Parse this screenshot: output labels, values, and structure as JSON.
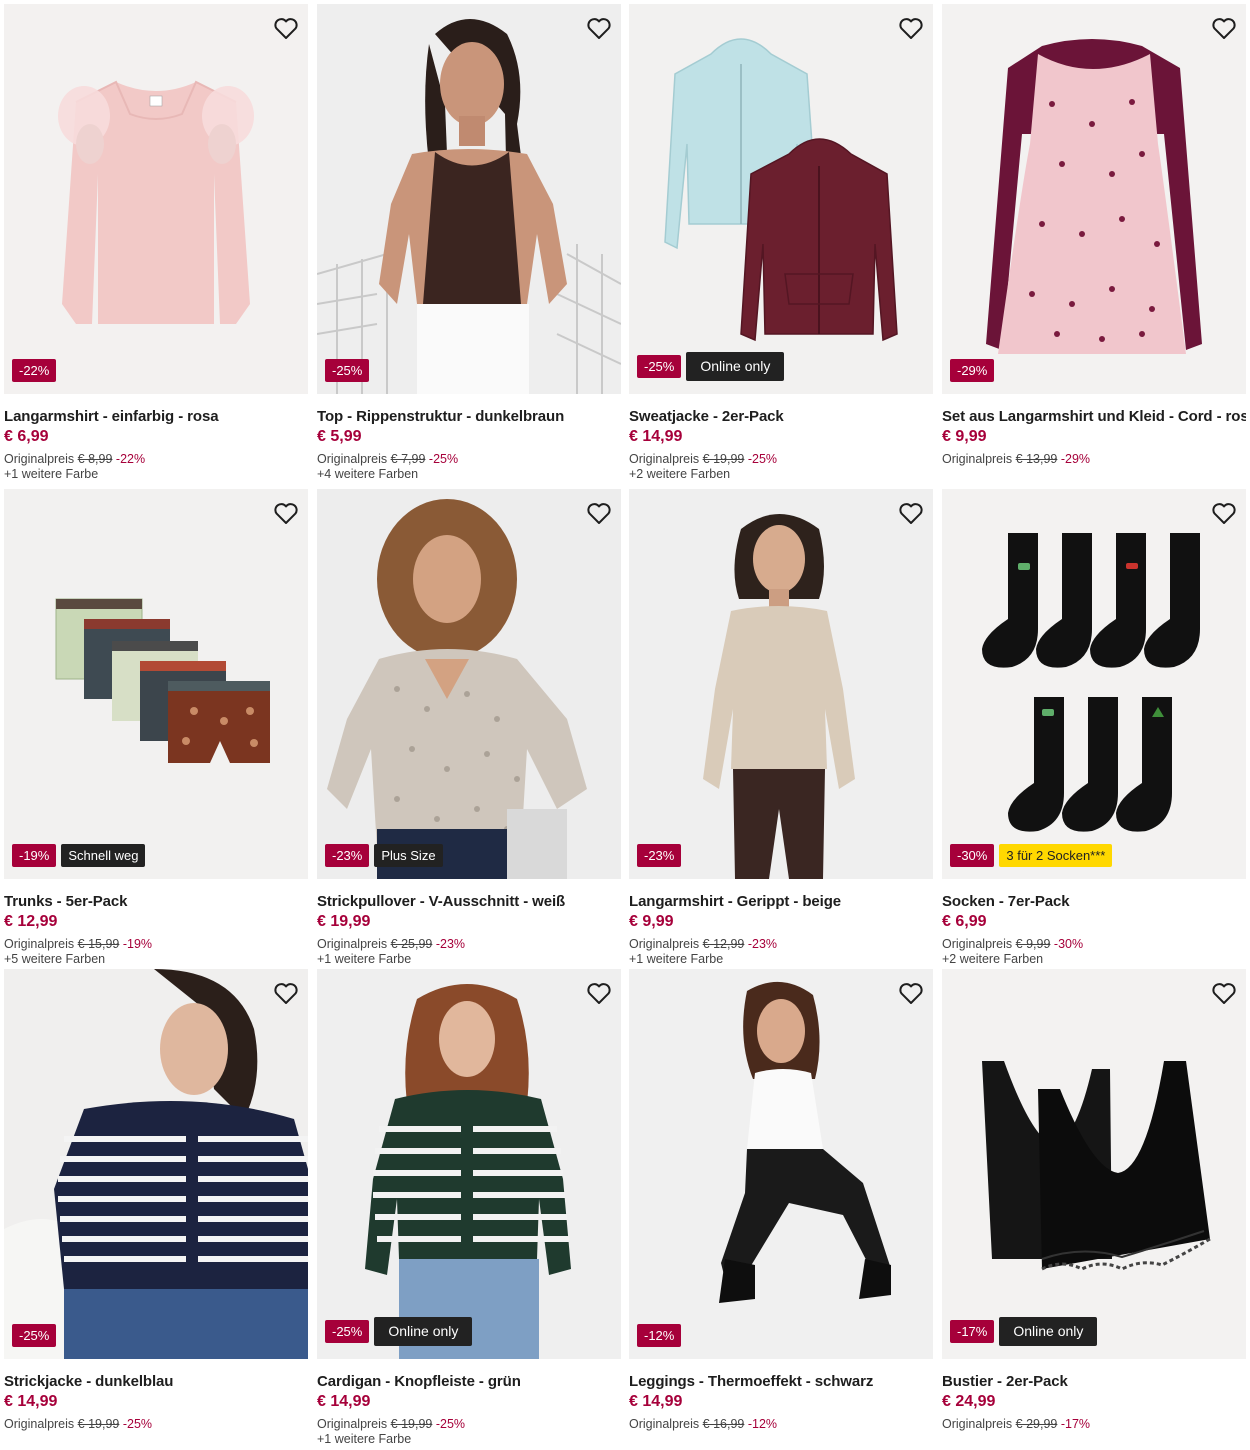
{
  "products": [
    {
      "name": "Langarmshirt - einfarbig - rosa",
      "price": "€ 6,99",
      "original_label": "Originalpreis",
      "original_price": "€ 8,99",
      "discount": "-22%",
      "discount_badge": "-22%",
      "extra_badge": "",
      "colors": "+1 weitere Farbe"
    },
    {
      "name": "Top - Rippenstruktur - dunkelbraun",
      "price": "€ 5,99",
      "original_label": "Originalpreis",
      "original_price": "€ 7,99",
      "discount": "-25%",
      "discount_badge": "-25%",
      "extra_badge": "",
      "colors": "+4 weitere Farben"
    },
    {
      "name": "Sweatjacke - 2er-Pack",
      "price": "€ 14,99",
      "original_label": "Originalpreis",
      "original_price": "€ 19,99",
      "discount": "-25%",
      "discount_badge": "-25%",
      "extra_badge": "Online only",
      "colors": "+2 weitere Farben"
    },
    {
      "name": "Set aus Langarmshirt und Kleid - Cord - rosa",
      "price": "€ 9,99",
      "original_label": "Originalpreis",
      "original_price": "€ 13,99",
      "discount": "-29%",
      "discount_badge": "-29%",
      "extra_badge": "",
      "colors": ""
    },
    {
      "name": "Trunks - 5er-Pack",
      "price": "€ 12,99",
      "original_label": "Originalpreis",
      "original_price": "€ 15,99",
      "discount": "-19%",
      "discount_badge": "-19%",
      "extra_badge": "Schnell weg",
      "colors": "+5 weitere Farben"
    },
    {
      "name": "Strickpullover - V-Ausschnitt - weiß",
      "price": "€ 19,99",
      "original_label": "Originalpreis",
      "original_price": "€ 25,99",
      "discount": "-23%",
      "discount_badge": "-23%",
      "extra_badge": "Plus Size",
      "colors": "+1 weitere Farbe"
    },
    {
      "name": "Langarmshirt - Gerippt - beige",
      "price": "€ 9,99",
      "original_label": "Originalpreis",
      "original_price": "€ 12,99",
      "discount": "-23%",
      "discount_badge": "-23%",
      "extra_badge": "",
      "colors": "+1 weitere Farbe"
    },
    {
      "name": "Socken - 7er-Pack",
      "price": "€ 6,99",
      "original_label": "Originalpreis",
      "original_price": "€ 9,99",
      "discount": "-30%",
      "discount_badge": "-30%",
      "extra_badge": "3 für 2 Socken***",
      "colors": "+2 weitere Farben"
    },
    {
      "name": "Strickjacke - dunkelblau",
      "price": "€ 14,99",
      "original_label": "Originalpreis",
      "original_price": "€ 19,99",
      "discount": "-25%",
      "discount_badge": "-25%",
      "extra_badge": "",
      "colors": ""
    },
    {
      "name": "Cardigan - Knopfleiste - grün",
      "price": "€ 14,99",
      "original_label": "Originalpreis",
      "original_price": "€ 19,99",
      "discount": "-25%",
      "discount_badge": "-25%",
      "extra_badge": "Online only",
      "colors": "+1 weitere Farbe"
    },
    {
      "name": "Leggings - Thermoeffekt - schwarz",
      "price": "€ 14,99",
      "original_label": "Originalpreis",
      "original_price": "€ 16,99",
      "discount": "-12%",
      "discount_badge": "-12%",
      "extra_badge": "",
      "colors": ""
    },
    {
      "name": "Bustier - 2er-Pack",
      "price": "€ 24,99",
      "original_label": "Originalpreis",
      "original_price": "€ 29,99",
      "discount": "-17%",
      "discount_badge": "-17%",
      "extra_badge": "Online only",
      "colors": ""
    }
  ],
  "icons": {
    "favorite": "heart-outline-icon"
  },
  "colors": {
    "price_accent": "#a6003a",
    "badge_dark": "#222222",
    "badge_yellow": "#ffd800",
    "image_bg": "#f0efee"
  }
}
